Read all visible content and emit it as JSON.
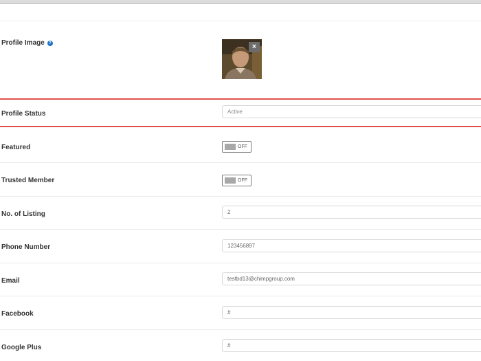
{
  "profile_image": {
    "label": "Profile Image",
    "help_icon": "question-circle-icon",
    "remove_icon": "close-icon"
  },
  "profile_status": {
    "label": "Profile Status",
    "value": "Active"
  },
  "featured": {
    "label": "Featured",
    "toggle_text": "OFF"
  },
  "trusted_member": {
    "label": "Trusted Member",
    "toggle_text": "OFF"
  },
  "listing": {
    "label": "No. of Listing",
    "value": "2"
  },
  "phone": {
    "label": "Phone Number",
    "value": "123456897"
  },
  "email": {
    "label": "Email",
    "value": "testbd13@chimpgroup.com"
  },
  "facebook": {
    "label": "Facebook",
    "value": "#"
  },
  "google_plus": {
    "label": "Google Plus",
    "value": "#"
  },
  "colors": {
    "highlight": "#e0504a",
    "help_icon": "#1e74c7"
  }
}
